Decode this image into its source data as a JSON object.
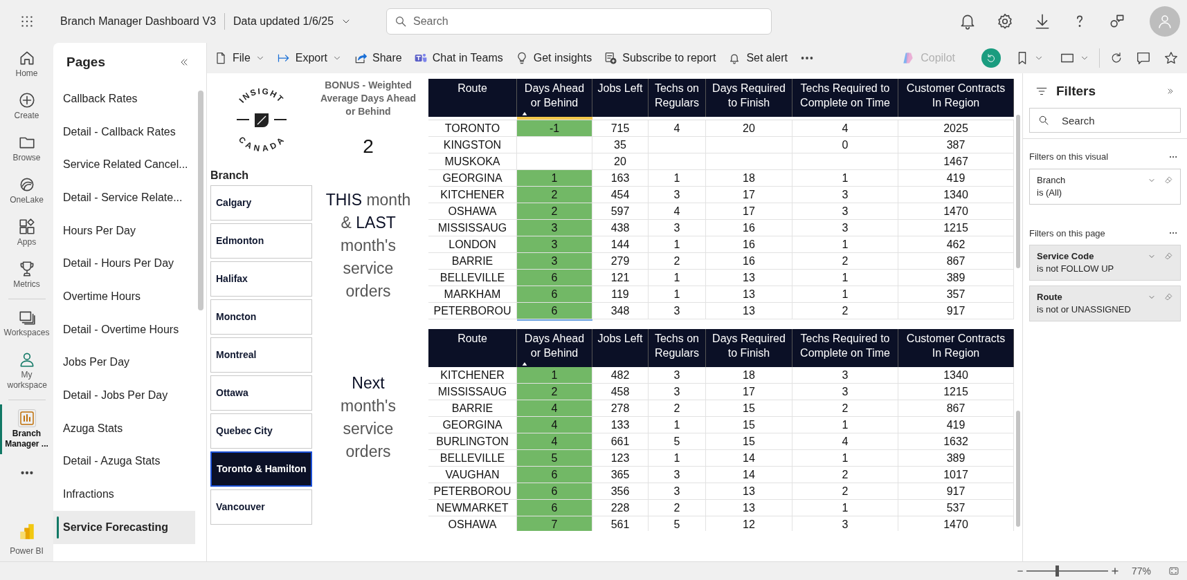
{
  "header": {
    "title": "Branch Manager Dashboard V3",
    "data_updated": "Data updated 1/6/25",
    "search_placeholder": "Search"
  },
  "rail": [
    {
      "label": "Home",
      "selected": false
    },
    {
      "label": "Create",
      "selected": false
    },
    {
      "label": "Browse",
      "selected": false
    },
    {
      "label": "OneLake",
      "selected": false
    },
    {
      "label": "Apps",
      "selected": false
    },
    {
      "label": "Metrics",
      "selected": false
    },
    {
      "label": "Workspaces",
      "selected": false
    },
    {
      "label": "My workspace",
      "selected": false
    },
    {
      "label": "Branch Manager ...",
      "selected": true
    }
  ],
  "rail_footer": "Power BI",
  "pages": {
    "title": "Pages",
    "items": [
      {
        "label": "Callback Rates",
        "selected": false
      },
      {
        "label": "Detail - Callback Rates",
        "selected": false
      },
      {
        "label": "Service Related Cancel...",
        "selected": false
      },
      {
        "label": "Detail - Service Relate...",
        "selected": false
      },
      {
        "label": "Hours Per Day",
        "selected": false
      },
      {
        "label": "Detail - Hours Per Day",
        "selected": false
      },
      {
        "label": "Overtime Hours",
        "selected": false
      },
      {
        "label": "Detail - Overtime Hours",
        "selected": false
      },
      {
        "label": "Jobs Per Day",
        "selected": false
      },
      {
        "label": "Detail - Jobs Per Day",
        "selected": false
      },
      {
        "label": "Azuga Stats",
        "selected": false
      },
      {
        "label": "Detail - Azuga Stats",
        "selected": false
      },
      {
        "label": "Infractions",
        "selected": false
      },
      {
        "label": "Service Forecasting",
        "selected": true
      }
    ]
  },
  "toolbar": [
    {
      "label": "File",
      "dropdown": true
    },
    {
      "label": "Export",
      "dropdown": true
    },
    {
      "label": "Share",
      "dropdown": false
    },
    {
      "label": "Chat in Teams",
      "dropdown": false
    },
    {
      "label": "Get insights",
      "dropdown": false
    },
    {
      "label": "Subscribe to report",
      "dropdown": false
    },
    {
      "label": "Set alert",
      "dropdown": false
    }
  ],
  "copilot": {
    "label": "Copilot",
    "disabled": true
  },
  "logo": {
    "top": "INSIGHT",
    "bottom": "CANADA"
  },
  "bonus": {
    "title": "BONUS - Weighted Average Days Ahead or Behind",
    "value": "2"
  },
  "branch_slicer": {
    "title": "Branch",
    "items": [
      {
        "label": "Calgary",
        "selected": false
      },
      {
        "label": "Edmonton",
        "selected": false
      },
      {
        "label": "Halifax",
        "selected": false
      },
      {
        "label": "Moncton",
        "selected": false
      },
      {
        "label": "Montreal",
        "selected": false
      },
      {
        "label": "Ottawa",
        "selected": false
      },
      {
        "label": "Quebec City",
        "selected": false
      },
      {
        "label": "Toronto & Hamilton",
        "selected": true
      },
      {
        "label": "Vancouver",
        "selected": false
      }
    ]
  },
  "notes": [
    "**THIS** month & **LAST** month's service orders",
    "**Next** month's service orders"
  ],
  "tables": [
    {
      "columns": [
        {
          "label": "Route",
          "sorted": false
        },
        {
          "label": "Days Ahead or Behind",
          "sorted": true
        },
        {
          "label": "Jobs Left",
          "sorted": false
        },
        {
          "label": "Techs on Regulars",
          "sorted": false
        },
        {
          "label": "Days Required to Finish",
          "sorted": false
        },
        {
          "label": "Techs Required to Complete on Time",
          "sorted": false
        },
        {
          "label": "Customer Contracts In Region",
          "sorted": false
        }
      ],
      "cut_row": {
        "color": "#f2c84b"
      },
      "rows": [
        {
          "cells": [
            "TORONTO",
            "-1",
            "715",
            "4",
            "20",
            "4",
            "2025"
          ],
          "color": "#72b866"
        },
        {
          "cells": [
            "KINGSTON",
            null,
            "35",
            null,
            null,
            "0",
            "387"
          ],
          "color": null
        },
        {
          "cells": [
            "MUSKOKA",
            null,
            "20",
            null,
            null,
            null,
            "1467"
          ],
          "color": null
        },
        {
          "cells": [
            "GEORGINA",
            "1",
            "163",
            "1",
            "18",
            "1",
            "419"
          ],
          "color": "#72b866"
        },
        {
          "cells": [
            "KITCHENER",
            "2",
            "454",
            "3",
            "17",
            "3",
            "1340"
          ],
          "color": "#72b866"
        },
        {
          "cells": [
            "OSHAWA",
            "2",
            "597",
            "4",
            "17",
            "3",
            "1470"
          ],
          "color": "#72b866"
        },
        {
          "cells": [
            "MISSISSAUG",
            "3",
            "438",
            "3",
            "16",
            "3",
            "1215"
          ],
          "color": "#72b866"
        },
        {
          "cells": [
            "LONDON",
            "3",
            "144",
            "1",
            "16",
            "1",
            "462"
          ],
          "color": "#72b866"
        },
        {
          "cells": [
            "BARRIE",
            "3",
            "279",
            "2",
            "16",
            "2",
            "867"
          ],
          "color": "#72b866"
        },
        {
          "cells": [
            "BELLEVILLE",
            "6",
            "121",
            "1",
            "13",
            "1",
            "389"
          ],
          "color": "#72b866"
        },
        {
          "cells": [
            "MARKHAM",
            "6",
            "119",
            "1",
            "13",
            "1",
            "357"
          ],
          "color": "#72b866"
        },
        {
          "cells": [
            "PETERBOROU",
            "6",
            "348",
            "3",
            "13",
            "2",
            "917"
          ],
          "color": "#72b866"
        }
      ]
    },
    {
      "columns": [
        {
          "label": "Route",
          "sorted": false
        },
        {
          "label": "Days Ahead or Behind",
          "sorted": true
        },
        {
          "label": "Jobs Left",
          "sorted": false
        },
        {
          "label": "Techs on Regulars",
          "sorted": false
        },
        {
          "label": "Days Required to Finish",
          "sorted": false
        },
        {
          "label": "Techs Required to Complete on Time",
          "sorted": false
        },
        {
          "label": "Customer Contracts In Region",
          "sorted": false
        }
      ],
      "rows": [
        {
          "cells": [
            "KITCHENER",
            "1",
            "482",
            "3",
            "18",
            "3",
            "1340"
          ],
          "color": "#72b866"
        },
        {
          "cells": [
            "MISSISSAUG",
            "2",
            "458",
            "3",
            "17",
            "3",
            "1215"
          ],
          "color": "#72b866"
        },
        {
          "cells": [
            "BARRIE",
            "4",
            "278",
            "2",
            "15",
            "2",
            "867"
          ],
          "color": "#72b866"
        },
        {
          "cells": [
            "GEORGINA",
            "4",
            "133",
            "1",
            "15",
            "1",
            "419"
          ],
          "color": "#72b866"
        },
        {
          "cells": [
            "BURLINGTON",
            "4",
            "661",
            "5",
            "15",
            "4",
            "1632"
          ],
          "color": "#72b866"
        },
        {
          "cells": [
            "BELLEVILLE",
            "5",
            "123",
            "1",
            "14",
            "1",
            "389"
          ],
          "color": "#72b866"
        },
        {
          "cells": [
            "VAUGHAN",
            "6",
            "365",
            "3",
            "14",
            "2",
            "1017"
          ],
          "color": "#72b866"
        },
        {
          "cells": [
            "PETERBOROU",
            "6",
            "356",
            "3",
            "13",
            "2",
            "917"
          ],
          "color": "#72b866"
        },
        {
          "cells": [
            "NEWMARKET",
            "6",
            "228",
            "2",
            "13",
            "1",
            "537"
          ],
          "color": "#72b866"
        },
        {
          "cells": [
            "OSHAWA",
            "7",
            "561",
            "5",
            "12",
            "3",
            "1470"
          ],
          "color": "#72b866"
        }
      ]
    }
  ],
  "filters": {
    "title": "Filters",
    "search_placeholder": "Search",
    "sections": [
      {
        "title": "Filters on this visual",
        "cards": [
          {
            "field": "Branch",
            "condition": "is (All)",
            "applied": false
          }
        ]
      },
      {
        "title": "Filters on this page",
        "cards": [
          {
            "field": "Service Code",
            "condition": "is not FOLLOW UP",
            "applied": true
          },
          {
            "field": "Route",
            "condition": "is not or UNASSIGNED",
            "applied": true
          }
        ]
      }
    ]
  },
  "zoom": {
    "level": 0.37,
    "reading": "77%"
  }
}
